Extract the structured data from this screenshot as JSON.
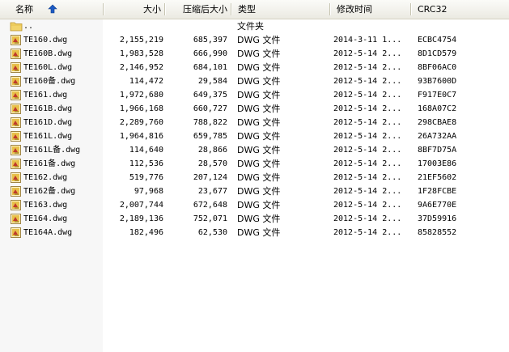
{
  "header": {
    "name": "名称",
    "size": "大小",
    "compressed_size": "压缩后大小",
    "type": "类型",
    "modified": "修改时间",
    "crc": "CRC32"
  },
  "colors": {
    "header_bg": "#ebeae2",
    "sorted_column_bg": "#f7f7f7",
    "folder": "#f2d36b",
    "file_icon": "#e8c14a"
  },
  "parent_row": {
    "name": "..",
    "type": "文件夹",
    "icon": "folder-up-icon"
  },
  "files": [
    {
      "name": "TE160.dwg",
      "size": "2,155,219",
      "compressed": "685,397",
      "type": "DWG 文件",
      "modified": "2014-3-11 1...",
      "crc": "ECBC4754"
    },
    {
      "name": "TE160B.dwg",
      "size": "1,983,528",
      "compressed": "666,990",
      "type": "DWG 文件",
      "modified": "2012-5-14 2...",
      "crc": "8D1CD579"
    },
    {
      "name": "TE160L.dwg",
      "size": "2,146,952",
      "compressed": "684,101",
      "type": "DWG 文件",
      "modified": "2012-5-14 2...",
      "crc": "8BF06AC0"
    },
    {
      "name": "TE160备.dwg",
      "size": "114,472",
      "compressed": "29,584",
      "type": "DWG 文件",
      "modified": "2012-5-14 2...",
      "crc": "93B7600D"
    },
    {
      "name": "TE161.dwg",
      "size": "1,972,680",
      "compressed": "649,375",
      "type": "DWG 文件",
      "modified": "2012-5-14 2...",
      "crc": "F917E0C7"
    },
    {
      "name": "TE161B.dwg",
      "size": "1,966,168",
      "compressed": "660,727",
      "type": "DWG 文件",
      "modified": "2012-5-14 2...",
      "crc": "168A07C2"
    },
    {
      "name": "TE161D.dwg",
      "size": "2,289,760",
      "compressed": "788,822",
      "type": "DWG 文件",
      "modified": "2012-5-14 2...",
      "crc": "298CBAE8"
    },
    {
      "name": "TE161L.dwg",
      "size": "1,964,816",
      "compressed": "659,785",
      "type": "DWG 文件",
      "modified": "2012-5-14 2...",
      "crc": "26A732AA"
    },
    {
      "name": "TE161L备.dwg",
      "size": "114,640",
      "compressed": "28,866",
      "type": "DWG 文件",
      "modified": "2012-5-14 2...",
      "crc": "8BF7D75A"
    },
    {
      "name": "TE161备.dwg",
      "size": "112,536",
      "compressed": "28,570",
      "type": "DWG 文件",
      "modified": "2012-5-14 2...",
      "crc": "17003E86"
    },
    {
      "name": "TE162.dwg",
      "size": "519,776",
      "compressed": "207,124",
      "type": "DWG 文件",
      "modified": "2012-5-14 2...",
      "crc": "21EF5602"
    },
    {
      "name": "TE162备.dwg",
      "size": "97,968",
      "compressed": "23,677",
      "type": "DWG 文件",
      "modified": "2012-5-14 2...",
      "crc": "1F28FCBE"
    },
    {
      "name": "TE163.dwg",
      "size": "2,007,744",
      "compressed": "672,648",
      "type": "DWG 文件",
      "modified": "2012-5-14 2...",
      "crc": "9A6E770E"
    },
    {
      "name": "TE164.dwg",
      "size": "2,189,136",
      "compressed": "752,071",
      "type": "DWG 文件",
      "modified": "2012-5-14 2...",
      "crc": "37D59916"
    },
    {
      "name": "TE164A.dwg",
      "size": "182,496",
      "compressed": "62,530",
      "type": "DWG 文件",
      "modified": "2012-5-14 2...",
      "crc": "85828552"
    }
  ]
}
